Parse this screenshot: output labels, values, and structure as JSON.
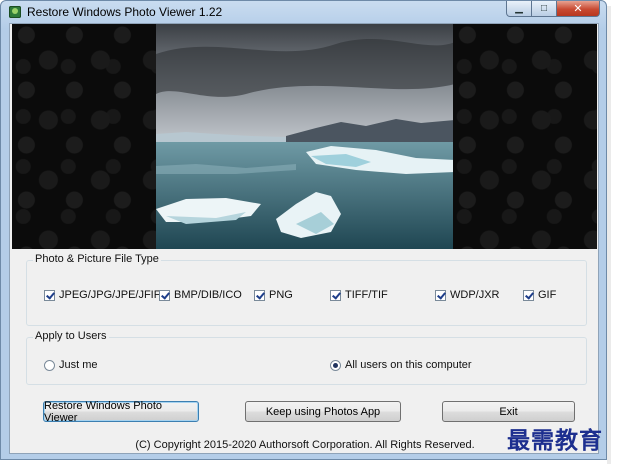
{
  "window": {
    "title": "Restore Windows Photo Viewer 1.22",
    "minimize_glyph": "▁",
    "maximize_glyph": "□",
    "close_glyph": "✕"
  },
  "file_types": {
    "group_title": "Photo & Picture File Type",
    "items": [
      {
        "label": "JPEG/JPG/JPE/JFIF",
        "checked": true
      },
      {
        "label": "BMP/DIB/ICO",
        "checked": true
      },
      {
        "label": "PNG",
        "checked": true
      },
      {
        "label": "TIFF/TIF",
        "checked": true
      },
      {
        "label": "WDP/JXR",
        "checked": true
      },
      {
        "label": "GIF",
        "checked": true
      }
    ]
  },
  "apply_users": {
    "group_title": "Apply to Users",
    "options": [
      {
        "label": "Just me",
        "selected": false
      },
      {
        "label": "All users on this computer",
        "selected": true
      }
    ]
  },
  "buttons": {
    "restore": "Restore Windows Photo Viewer",
    "keep": "Keep using Photos App",
    "exit": "Exit"
  },
  "copyright": "(C) Copyright 2015-2020 Authorsoft Corporation. All Rights Reserved.",
  "watermark": "最需教育",
  "colors": {
    "window_frame": "#b4cde8",
    "close_button": "#c84a32",
    "watermark": "#1d2f8f"
  }
}
